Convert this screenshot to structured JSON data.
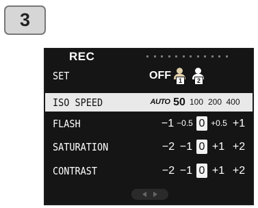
{
  "step_number": "3",
  "screen": {
    "title": "REC",
    "rows": {
      "set": {
        "label": "SET",
        "off": "OFF",
        "user1": "1",
        "user2": "2"
      },
      "iso": {
        "label": "ISO SPEED",
        "options": [
          "AUTO",
          "50",
          "100",
          "200",
          "400"
        ]
      },
      "flash": {
        "label": "FLASH",
        "options": [
          "−1",
          "−0.5",
          "0",
          "+0.5",
          "+1"
        ]
      },
      "saturation": {
        "label": "SATURATION",
        "options": [
          "−2",
          "−1",
          "0",
          "+1",
          "+2"
        ]
      },
      "contrast": {
        "label": "CONTRAST",
        "options": [
          "−2",
          "−1",
          "0",
          "+1",
          "+2"
        ]
      }
    },
    "selected": {
      "set": "user1",
      "iso": "AUTO",
      "flash": "0",
      "saturation": "0",
      "contrast": "0"
    },
    "highlighted_row": "iso",
    "colors": {
      "screen_bg": "#151515",
      "highlight_bg": "#e9e9e9",
      "selected_user_icon": "#e0cfa8"
    },
    "icons": {
      "user_setting": "person-icon",
      "nav_left": "left-arrow-icon",
      "nav_right": "right-arrow-icon"
    }
  }
}
